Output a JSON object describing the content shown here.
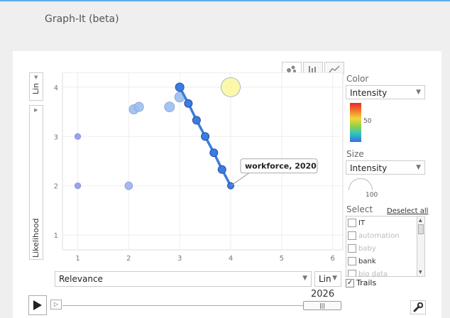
{
  "app": {
    "title": "Graph-It (beta)"
  },
  "yaxis": {
    "scale": "Lin",
    "variable": "Likelihood"
  },
  "xaxis": {
    "variable": "Relevance",
    "scale": "Lin"
  },
  "view_tabs": [
    {
      "icon": "bubble-chart-icon",
      "active": true
    },
    {
      "icon": "bar-chart-icon",
      "active": false
    },
    {
      "icon": "line-chart-icon",
      "active": false
    }
  ],
  "color": {
    "label": "Color",
    "value": "Intensity",
    "legend_value": "50"
  },
  "size": {
    "label": "Size",
    "value": "Intensity",
    "legend_value": "100"
  },
  "select": {
    "label": "Select",
    "deselect_label": "Deselect all",
    "items": [
      {
        "label": "IT",
        "dim": false
      },
      {
        "label": "automation",
        "dim": true
      },
      {
        "label": "baby",
        "dim": true
      },
      {
        "label": "bank",
        "dim": false
      },
      {
        "label": "big data",
        "dim": true
      }
    ]
  },
  "trails": {
    "label": "Trails",
    "checked": true,
    "check_mark": "✓"
  },
  "timeline": {
    "year": "2026",
    "thumb_glyph": "|||",
    "speed_glyph": "▷"
  },
  "tooltip": {
    "text": "workforce, 2020"
  },
  "chart_data": {
    "type": "scatter",
    "xlim": [
      0.7,
      6.2
    ],
    "ylim": [
      0.7,
      4.3
    ],
    "x_ticks": [
      "1",
      "2",
      "3",
      "4",
      "5",
      "6"
    ],
    "y_ticks": [
      "1",
      "2",
      "3",
      "4"
    ],
    "grid": true,
    "bubbles": [
      {
        "x": 1.0,
        "y": 3.0,
        "size": 1,
        "color": "#8f97ee"
      },
      {
        "x": 1.0,
        "y": 2.0,
        "size": 1,
        "color": "#8f97ee"
      },
      {
        "x": 2.0,
        "y": 2.0,
        "size": 1.5,
        "color": "#98b4f0"
      },
      {
        "x": 2.1,
        "y": 3.55,
        "size": 2,
        "color": "#98c0f0"
      },
      {
        "x": 2.2,
        "y": 3.6,
        "size": 2,
        "color": "#98c0f0"
      },
      {
        "x": 2.8,
        "y": 3.6,
        "size": 2.2,
        "color": "#98c0f0"
      },
      {
        "x": 3.0,
        "y": 3.8,
        "size": 2.2,
        "color": "#98c0f0"
      },
      {
        "x": 4.0,
        "y": 4.0,
        "size": 5,
        "color": "#faf8a0"
      }
    ],
    "trail": {
      "name": "workforce",
      "color": "#3a7de0",
      "points": [
        {
          "x": 3.0,
          "y": 4.0
        },
        {
          "x": 3.17,
          "y": 3.67
        },
        {
          "x": 3.33,
          "y": 3.33
        },
        {
          "x": 3.5,
          "y": 3.0
        },
        {
          "x": 3.67,
          "y": 2.67
        },
        {
          "x": 3.83,
          "y": 2.33
        },
        {
          "x": 4.0,
          "y": 2.0
        }
      ]
    }
  }
}
